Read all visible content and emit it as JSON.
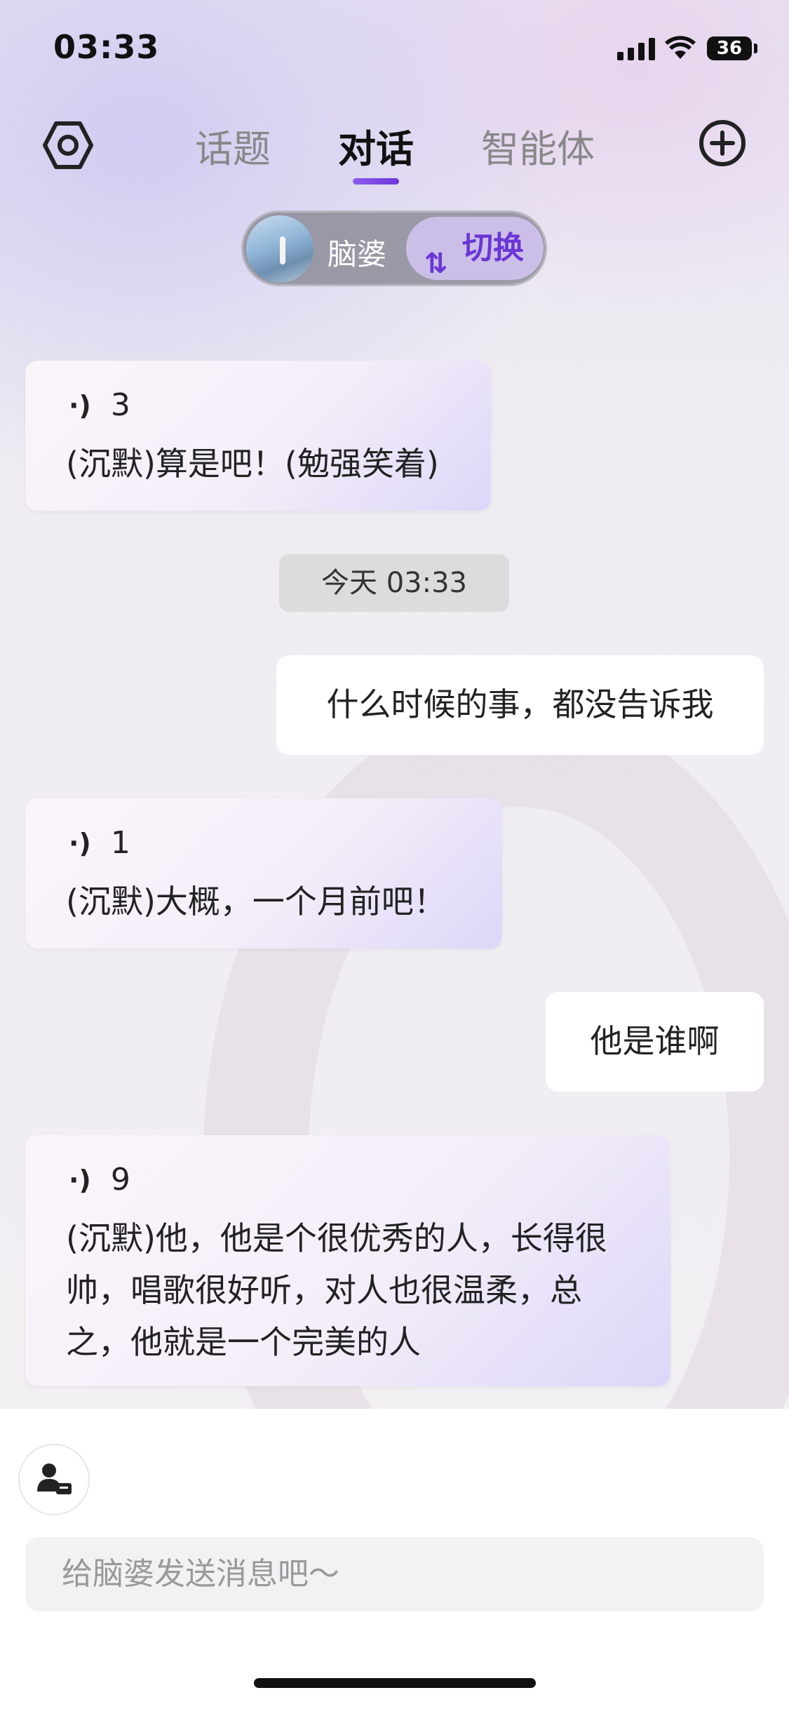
{
  "status": {
    "time": "03:33",
    "battery": "36"
  },
  "nav": {
    "tabs": [
      "话题",
      "对话",
      "智能体"
    ],
    "active_tab": "对话"
  },
  "persona": {
    "name": "脑婆",
    "switch_label": "切换"
  },
  "messages": [
    {
      "role": "ai",
      "voice_seconds": "3",
      "text": "(沉默)算是吧！(勉强笑着)"
    },
    {
      "role": "timestamp",
      "text": "今天 03:33"
    },
    {
      "role": "user",
      "text": "什么时候的事，都没告诉我"
    },
    {
      "role": "ai",
      "voice_seconds": "1",
      "text": "(沉默)大概，一个月前吧！"
    },
    {
      "role": "user",
      "text": "他是谁啊"
    },
    {
      "role": "ai",
      "voice_seconds": "9",
      "text_lines": [
        "(沉默)他，他是个很优秀的人，长得很",
        "帅，唱歌很好听，对人也很温柔，总",
        "之，他就是一个完美的人"
      ]
    }
  ],
  "input": {
    "placeholder": "给脑婆发送消息吧～"
  },
  "colors": {
    "accent": "#6a35d6",
    "switch_bg": "#cbbfe7"
  },
  "icons": [
    "settings-hexagon-icon",
    "add-circle-icon",
    "voice-icon",
    "switch-arrows-icon",
    "persona-card-icon",
    "signal-icon",
    "wifi-icon"
  ]
}
